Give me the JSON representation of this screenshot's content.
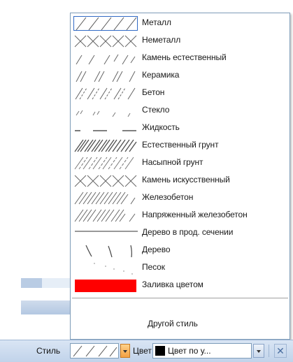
{
  "hatch_styles": [
    {
      "label": "Металл",
      "icon": "metal-hatch"
    },
    {
      "label": "Неметалл",
      "icon": "nonmetal-hatch"
    },
    {
      "label": "Камень естественный",
      "icon": "natural-stone-hatch"
    },
    {
      "label": "Керамика",
      "icon": "ceramics-hatch"
    },
    {
      "label": "Бетон",
      "icon": "concrete-hatch"
    },
    {
      "label": "Стекло",
      "icon": "glass-hatch"
    },
    {
      "label": "Жидкость",
      "icon": "liquid-hatch"
    },
    {
      "label": "Естественный грунт",
      "icon": "natural-soil-hatch"
    },
    {
      "label": "Насыпной грунт",
      "icon": "fill-soil-hatch"
    },
    {
      "label": "Камень искусственный",
      "icon": "artificial-stone-hatch"
    },
    {
      "label": "Железобетон",
      "icon": "reinforced-concrete-hatch"
    },
    {
      "label": "Напряженный железобетон",
      "icon": "prestressed-concrete-hatch"
    },
    {
      "label": "Дерево в прод. сечении",
      "icon": "wood-longitudinal-hatch"
    },
    {
      "label": "Дерево",
      "icon": "wood-hatch"
    },
    {
      "label": "Песок",
      "icon": "sand-hatch"
    },
    {
      "label": "Заливка цветом",
      "icon": "color-fill-swatch",
      "color": "#ff0000"
    }
  ],
  "other_style_label": "Другой стиль",
  "toolbar": {
    "style_label": "Стиль",
    "color_label": "Цвет",
    "color_value": "Цвет по у...",
    "color_swatch": "#000000",
    "dropdown_icon": "chevron-down-icon",
    "close_icon": "close-icon"
  }
}
